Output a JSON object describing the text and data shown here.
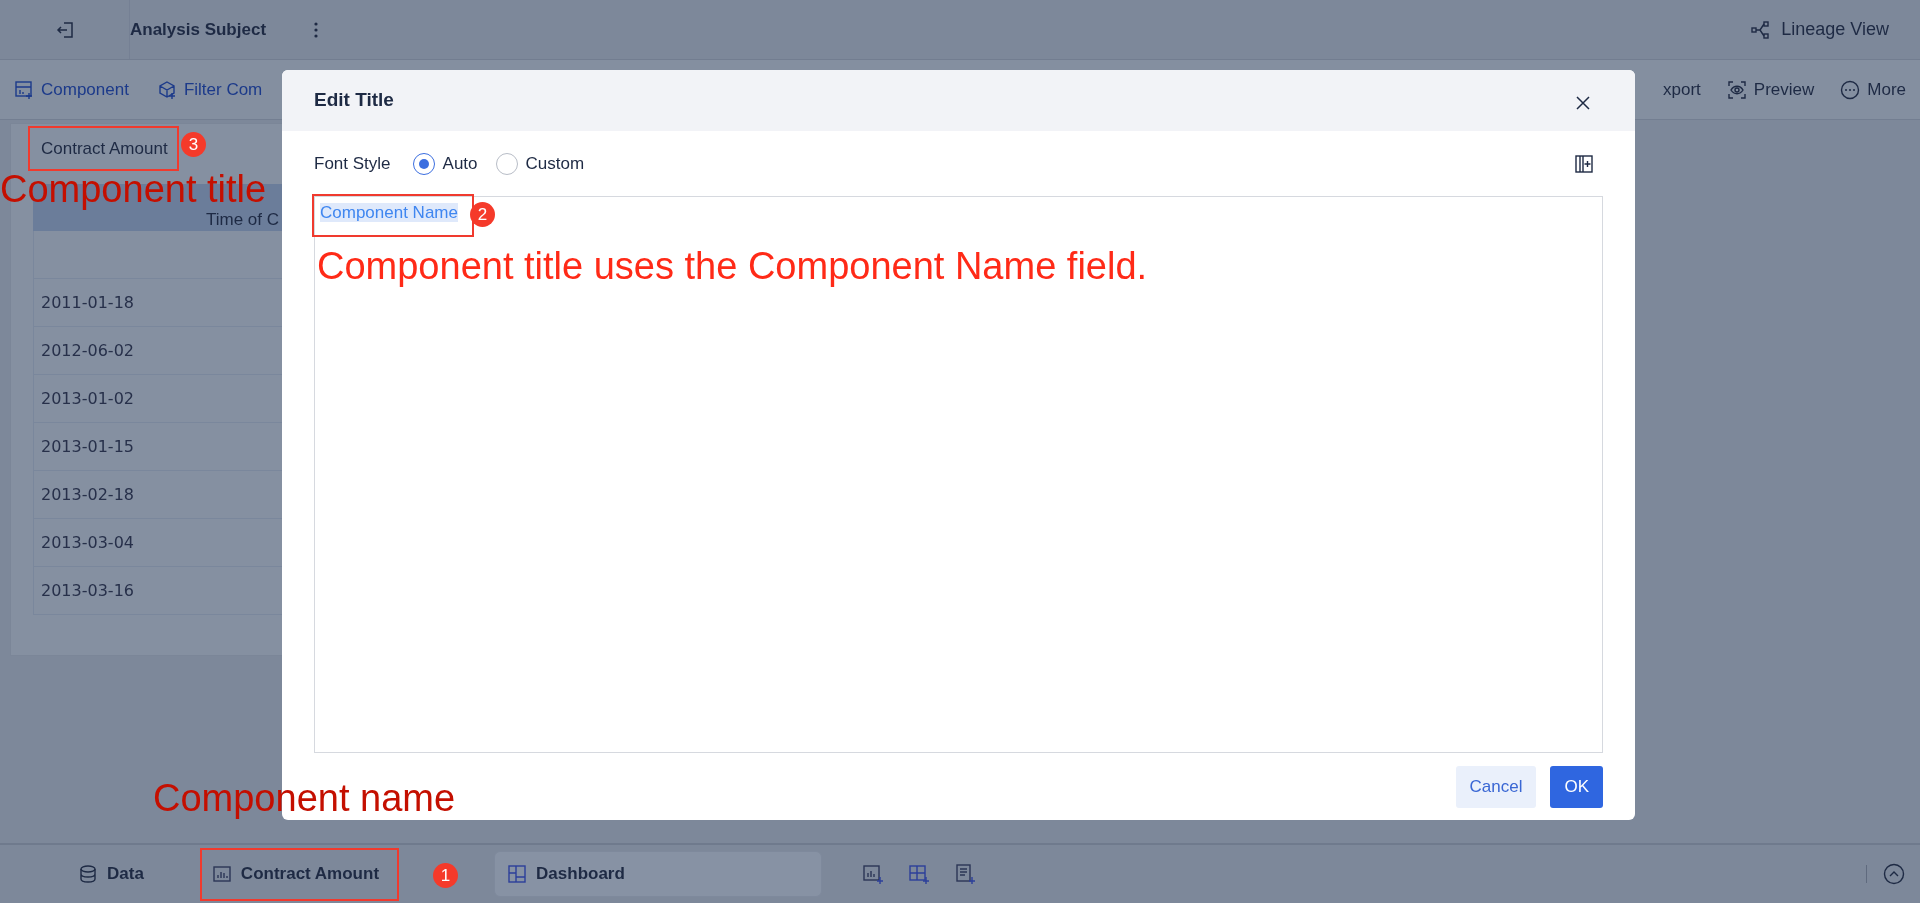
{
  "top_bar": {
    "title": "Analysis Subject",
    "lineage_view": "Lineage View"
  },
  "toolbar": {
    "left": [
      {
        "kind": "component",
        "label": "Component"
      },
      {
        "kind": "filter",
        "label": "Filter Com"
      }
    ],
    "right": [
      {
        "kind": "export",
        "label": "xport"
      },
      {
        "kind": "preview",
        "label": "Preview"
      },
      {
        "kind": "more",
        "label": "More"
      }
    ]
  },
  "component_card": {
    "title": "Contract Amount",
    "table": {
      "columns": [
        "Time of C"
      ],
      "rows": [
        "2011-01-18",
        "2012-06-02",
        "2013-01-02",
        "2013-01-15",
        "2013-02-18",
        "2013-03-04",
        "2013-03-16"
      ]
    }
  },
  "dialog": {
    "title": "Edit Title",
    "font_style": {
      "label": "Font Style",
      "options": [
        {
          "label": "Auto",
          "selected": true
        },
        {
          "label": "Custom",
          "selected": false
        }
      ]
    },
    "editor": {
      "content": "Component Name"
    },
    "buttons": [
      {
        "kind": "secondary",
        "label": "Cancel"
      },
      {
        "kind": "primary",
        "label": "OK"
      }
    ]
  },
  "bottom_tabs": [
    {
      "kind": "data",
      "label": "Data",
      "selected": false
    },
    {
      "kind": "component",
      "label": "Contract Amount",
      "selected": false
    },
    {
      "kind": "dashboard",
      "label": "Dashboard",
      "selected": true
    }
  ],
  "annotations": {
    "badges": [
      "1",
      "2",
      "3"
    ],
    "labels": [
      "Component title",
      "Component name",
      "Component title uses the Component Name field."
    ]
  }
}
